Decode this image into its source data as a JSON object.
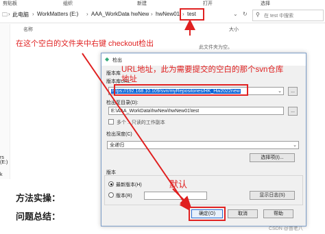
{
  "ribbon": {
    "items": [
      "剪贴板",
      "组织",
      "新建",
      "打开",
      "选择"
    ]
  },
  "address": {
    "crumbs": [
      "此电脑",
      "WorkMatters (E:)",
      "AAA_WorkData",
      "hwNew",
      "hwNew01",
      "test"
    ],
    "search_placeholder": "在 test 中搜索"
  },
  "columns": {
    "name": "名称",
    "size": "大小"
  },
  "empty_text": "此文件夹为空。",
  "left_nav": {
    "item1": "rs (E:)",
    "item2": "k"
  },
  "annotations": {
    "right_click": "在这个空白的文件夹中右键 checkout检出",
    "url_line1": "URL地址，此为需要提交的空白的那个svn仓库",
    "url_line2": "地址",
    "default": "默认"
  },
  "dialog": {
    "title": "检出",
    "repo_group": "版本库",
    "repo_url_label": "版本库URL:",
    "repo_url": "https://192.168.10.109/svn/myRepositories/HK_Hw2022new",
    "checkout_dir_label": "检出至目录(D):",
    "checkout_dir": "E:\\AAA_WorkData\\hwNew\\hwNew01\\test",
    "checkbox_label": "多个 ...只读的工作副本",
    "depth_group": "检出深度(C)",
    "depth_value": "全递归",
    "choose_items": "选择项(I)...",
    "revision_group": "版本",
    "head_label": "最新版本(H)",
    "revision_label": "版本(R)",
    "show_log": "显示日志(S)",
    "ok": "确定(O)",
    "cancel": "取消",
    "help": "帮助",
    "browse": "..."
  },
  "doc": {
    "line1": "方法实操：",
    "line2": "问题总结："
  },
  "watermark": "CSDN @苗老八",
  "colors": {
    "annotation": "#e02020",
    "selection": "#0a64d6"
  }
}
